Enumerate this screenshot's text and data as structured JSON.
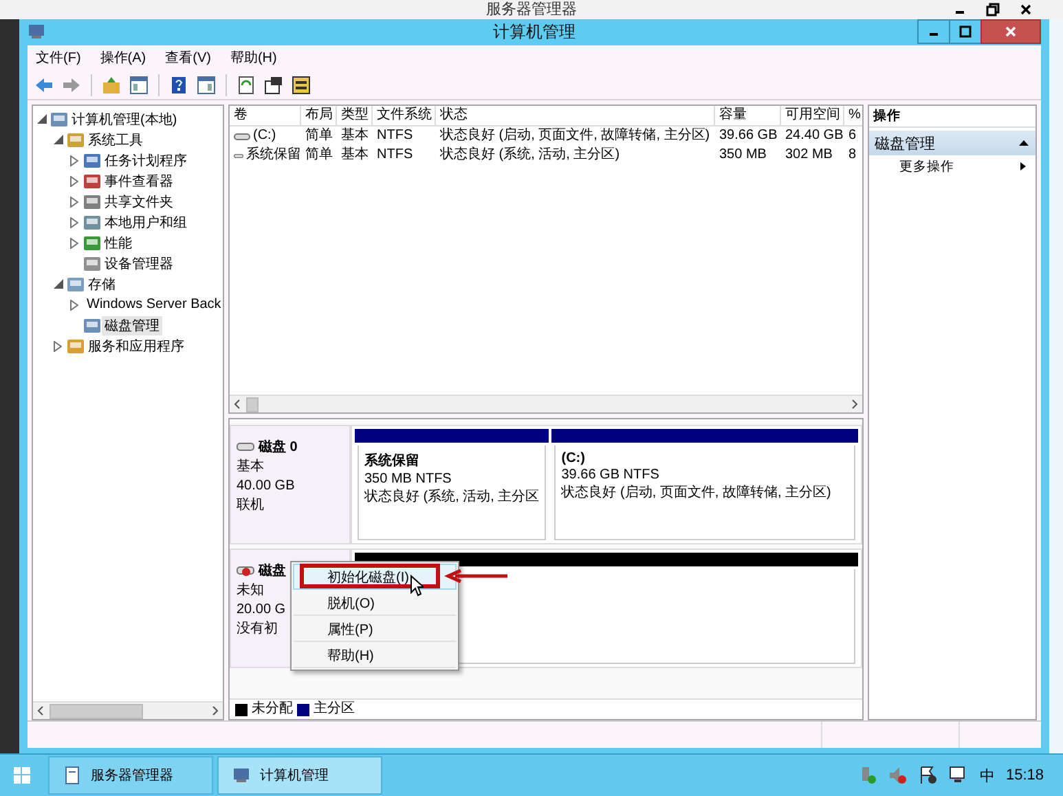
{
  "outer_window": {
    "title": "服务器管理器"
  },
  "window": {
    "title": "计算机管理"
  },
  "menu": [
    "文件(F)",
    "操作(A)",
    "查看(V)",
    "帮助(H)"
  ],
  "tree": [
    {
      "label": "计算机管理(本地)",
      "expanded": true,
      "children": [
        {
          "label": "系统工具",
          "expanded": true,
          "children": [
            {
              "label": "任务计划程序",
              "expanded": false
            },
            {
              "label": "事件查看器",
              "expanded": false
            },
            {
              "label": "共享文件夹",
              "expanded": false
            },
            {
              "label": "本地用户和组",
              "expanded": false
            },
            {
              "label": "性能",
              "expanded": false
            },
            {
              "label": "设备管理器"
            }
          ]
        },
        {
          "label": "存储",
          "expanded": true,
          "children": [
            {
              "label": "Windows Server Back",
              "expanded": false
            },
            {
              "label": "磁盘管理",
              "selected": true
            }
          ]
        },
        {
          "label": "服务和应用程序",
          "expanded": false
        }
      ]
    }
  ],
  "table": {
    "columns": [
      "卷",
      "布局",
      "类型",
      "文件系统",
      "状态",
      "容量",
      "可用空间",
      "%"
    ],
    "rows": [
      [
        "(C:)",
        "简单",
        "基本",
        "NTFS",
        "状态良好 (启动, 页面文件, 故障转储, 主分区)",
        "39.66 GB",
        "24.40 GB",
        "6"
      ],
      [
        "系统保留",
        "简单",
        "基本",
        "NTFS",
        "状态良好 (系统, 活动, 主分区)",
        "350 MB",
        "302 MB",
        "8"
      ]
    ]
  },
  "disks": [
    {
      "name": "磁盘 0",
      "lines": [
        "基本",
        "40.00 GB",
        "联机"
      ],
      "partitions": [
        {
          "name": "系统保留",
          "size": "350 MB NTFS",
          "status": "状态良好 (系统, 活动, 主分区",
          "color": "#000080"
        },
        {
          "name": "(C:)",
          "size": "39.66 GB NTFS",
          "status": "状态良好 (启动, 页面文件, 故障转储, 主分区)",
          "color": "#000080"
        }
      ]
    },
    {
      "name": "磁盘",
      "lines": [
        "未知",
        "20.00 G",
        "没有初"
      ],
      "partitions": [
        {
          "color": "#000000"
        }
      ]
    }
  ],
  "context_menu": [
    {
      "label": "初始化磁盘(I)",
      "selected": true
    },
    {
      "label": "脱机(O)",
      "selected": false
    },
    {
      "label": "属性(P)",
      "selected": false
    },
    {
      "label": "帮助(H)",
      "selected": false
    }
  ],
  "legend": [
    {
      "label": "未分配",
      "color": "#000000"
    },
    {
      "label": "主分区",
      "color": "#000080"
    }
  ],
  "actions": {
    "header": "操作",
    "section": "磁盘管理",
    "items": [
      "更多操作"
    ]
  },
  "taskbar": {
    "buttons": [
      {
        "label": "服务器管理器",
        "selected": false
      },
      {
        "label": "计算机管理",
        "selected": true
      }
    ],
    "ime": "中",
    "time": "15:18"
  }
}
